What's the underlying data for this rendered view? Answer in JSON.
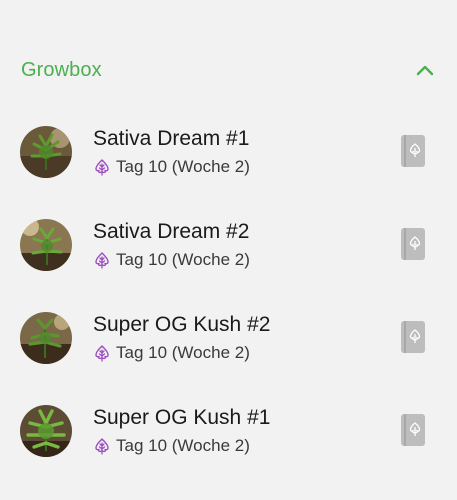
{
  "section": {
    "title": "Growbox",
    "accent_color": "#4caf50",
    "collapse_icon": "chevron-up-icon"
  },
  "plants": [
    {
      "name": "Sativa Dream #1",
      "age": "Tag 10 (Woche 2)"
    },
    {
      "name": "Sativa Dream #2",
      "age": "Tag 10 (Woche 2)"
    },
    {
      "name": "Super OG Kush #2",
      "age": "Tag 10 (Woche 2)"
    },
    {
      "name": "Super OG Kush #1",
      "age": "Tag 10 (Woche 2)"
    }
  ],
  "icons": {
    "stage_icon": "plant-icon",
    "stage_icon_color": "#9c4fbf",
    "diary_icon": "diary-book-icon",
    "diary_icon_color": "#bdbdbd"
  }
}
